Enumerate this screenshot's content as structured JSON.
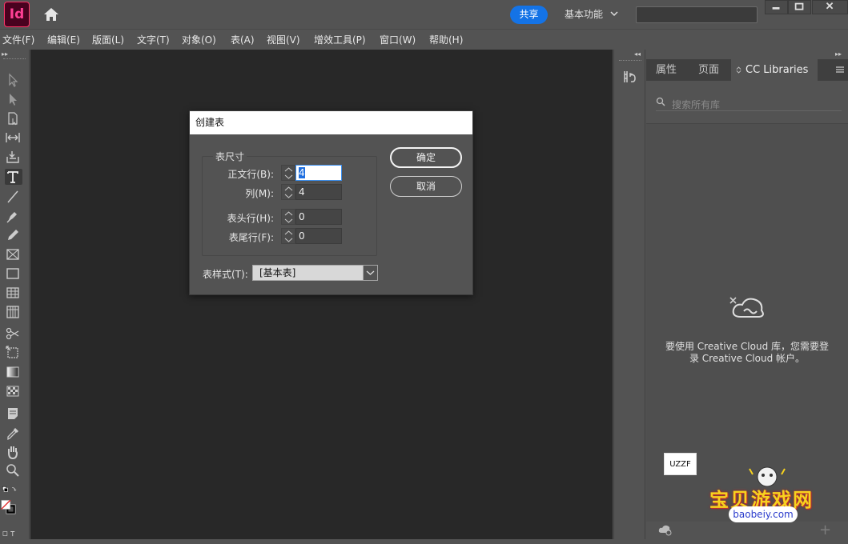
{
  "app": {
    "logo_text": "Id",
    "share_label": "共享",
    "workspace_label": "基本功能"
  },
  "menu": [
    "文件(F)",
    "编辑(E)",
    "版面(L)",
    "文字(T)",
    "对象(O)",
    "表(A)",
    "视图(V)",
    "增效工具(P)",
    "窗口(W)",
    "帮助(H)"
  ],
  "panel": {
    "tabs": [
      "属性",
      "页面",
      "CC Libraries"
    ],
    "search_placeholder": "搜索所有库",
    "message": "要使用 Creative Cloud 库，您需要登录 Creative Cloud 帐户。"
  },
  "dialog": {
    "title": "创建表",
    "group_label": "表尺寸",
    "fields": [
      {
        "label": "正文行(B):",
        "value": "4"
      },
      {
        "label": "列(M):",
        "value": "4"
      },
      {
        "label": "表头行(H):",
        "value": "0"
      },
      {
        "label": "表尾行(F):",
        "value": "0"
      }
    ],
    "ok_label": "确定",
    "cancel_label": "取消",
    "style_label": "表样式(T):",
    "style_value": "[基本表]"
  },
  "watermark": {
    "badge": "UZZF",
    "title": "宝贝游戏网",
    "url": "baobeiy.com"
  },
  "colors": {
    "accent": "#1473e6",
    "app_brand": "#ff3f94",
    "canvas": "#282828"
  }
}
